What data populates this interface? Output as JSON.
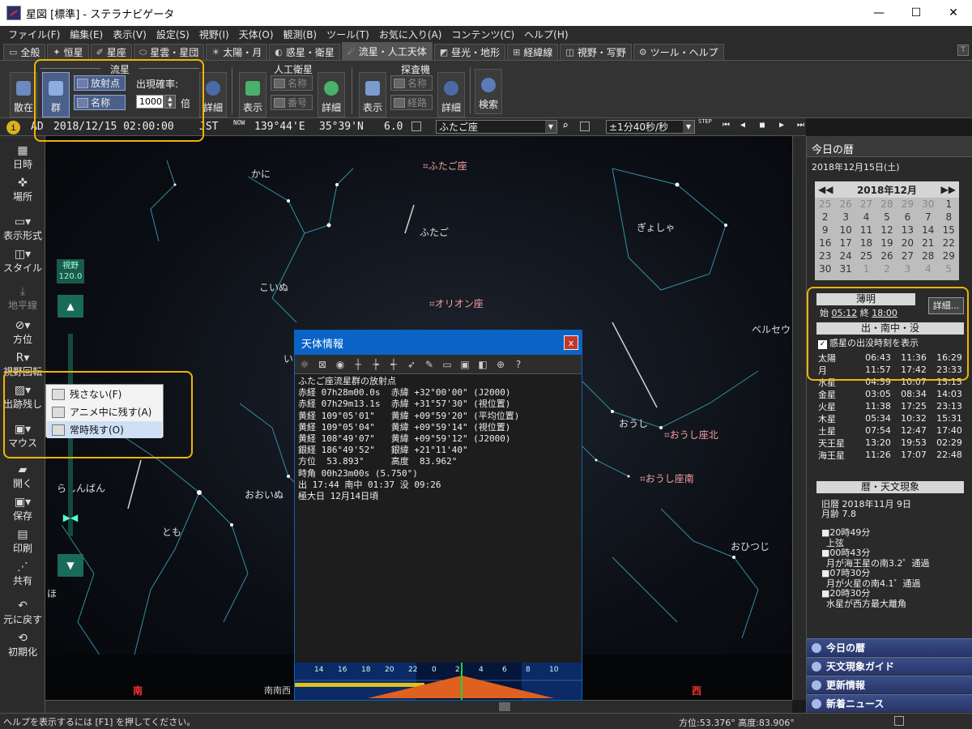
{
  "window": {
    "title": "星図 [標準] - ステラナビゲータ",
    "min": "—",
    "max": "☐",
    "close": "✕"
  },
  "menu": [
    "ファイル(F)",
    "編集(E)",
    "表示(V)",
    "設定(S)",
    "視野(I)",
    "天体(O)",
    "観測(B)",
    "ツール(T)",
    "お気に入り(A)",
    "コンテンツ(C)",
    "ヘルプ(H)"
  ],
  "tabs": [
    {
      "label": "全般",
      "icon": "▭"
    },
    {
      "label": "恒星",
      "icon": "✦"
    },
    {
      "label": "星座",
      "icon": "✐"
    },
    {
      "label": "星雲・星団",
      "icon": "⬭"
    },
    {
      "label": "太陽・月",
      "icon": "☀"
    },
    {
      "label": "惑星・衛星",
      "icon": "◐"
    },
    {
      "label": "流星・人工天体",
      "icon": "☄"
    },
    {
      "label": "昼光・地形",
      "icon": "◩"
    },
    {
      "label": "経緯線",
      "icon": "⊞"
    },
    {
      "label": "視野・写野",
      "icon": "◫"
    },
    {
      "label": "ツール・ヘルプ",
      "icon": "⚙"
    }
  ],
  "ribbon": {
    "meteor": {
      "title": "流星",
      "scatter": "散在",
      "group": "群",
      "radiant": "放射点",
      "name": "名称",
      "rate_label": "出現確率:",
      "rate_value": "1000",
      "rate_unit": "倍",
      "detail": "詳細"
    },
    "satellite": {
      "title": "人工衛星",
      "show": "表示",
      "name": "名称",
      "number": "番号",
      "detail": "詳細"
    },
    "probe": {
      "title": "探査機",
      "show": "表示",
      "name": "名称",
      "path": "経路",
      "detail": "詳細"
    },
    "search": "検索"
  },
  "infobar": {
    "era": "AD",
    "datetime": "2018/12/15 02:00:00",
    "tz": "JST",
    "now": "NOW",
    "lon": "139°44'E",
    "lat": "35°39'N",
    "mag": "6.0",
    "constellation": "ふたご座",
    "step": "±1分40秒/秒",
    "step_label": "STEP"
  },
  "left_toolbar": {
    "datetime": "日時",
    "place": "場所",
    "display": "表示形式",
    "style": "スタイル",
    "horizon": "地平線",
    "direction": "方位",
    "view_rotate": "視野回転",
    "trail": "出跡残し",
    "mouse": "マウス",
    "open": "開く",
    "save": "保存",
    "print": "印刷",
    "share": "共有",
    "undo": "元に戻す",
    "reset": "初期化"
  },
  "zoom": {
    "label": "視野",
    "value": "120.0"
  },
  "popup": {
    "items": [
      {
        "label": "残さない(F)"
      },
      {
        "label": "アニメ中に残す(A)"
      },
      {
        "label": "常時残す(O)"
      }
    ]
  },
  "sky_labels": {
    "kani": "かに",
    "futago": "ふたご",
    "futago_radiant": "ふたご座",
    "koinu": "こいぬ",
    "orion_radiant": "オリオン座",
    "gyosha": "ぎょしゃ",
    "perseus": "ベルセウ",
    "oushi": "おうし",
    "oushi_north": "おうし座北",
    "oushi_south": "おうし座南",
    "ooinu": "おおいぬ",
    "rashinban": "らしんばん",
    "tomo": "とも",
    "ohitsuji": "おひつじ",
    "i": "い",
    "ho": "ほ",
    "south": "南",
    "ssw": "南南西",
    "west": "西"
  },
  "dialog": {
    "title": "天体情報",
    "close": "x",
    "lines": [
      "ふたご座流星群の放射点",
      "赤経 07h28m00.0s  赤緯 +32°00'00\" (J2000)",
      "赤経 07h29m13.1s  赤緯 +31°57'30\" (視位置)",
      "黄経 109°05'01\"   黄緯 +09°59'20\" (平均位置)",
      "黄経 109°05'04\"   黄緯 +09°59'14\" (視位置)",
      "黄経 108°49'07\"   黄緯 +09°59'12\" (J2000)",
      "銀経 186°49'52\"   銀緯 +21°11'40\"",
      "方位  53.893°     高度  83.962°",
      "時角 00h23m00s (5.750°)",
      "出 17:44 南中 01:37 没 09:26",
      "極大日 12月14日頃"
    ],
    "hours": [
      "14",
      "16",
      "18",
      "20",
      "22",
      "0",
      "2",
      "4",
      "6",
      "8",
      "10"
    ]
  },
  "right_panel": {
    "title": "今日の暦",
    "date": "2018年12月15日(土)",
    "calendar": {
      "month": "2018年12月",
      "prev2": "◀◀",
      "prev": "◀",
      "next": "▶",
      "next2": "▶▶",
      "rows": [
        [
          "25",
          "26",
          "27",
          "28",
          "29",
          "30",
          "1"
        ],
        [
          "2",
          "3",
          "4",
          "5",
          "6",
          "7",
          "8"
        ],
        [
          "9",
          "10",
          "11",
          "12",
          "13",
          "14",
          "15"
        ],
        [
          "16",
          "17",
          "18",
          "19",
          "20",
          "21",
          "22"
        ],
        [
          "23",
          "24",
          "25",
          "26",
          "27",
          "28",
          "29"
        ],
        [
          "30",
          "31",
          "1",
          "2",
          "3",
          "4",
          "5"
        ]
      ]
    },
    "twilight": {
      "title": "薄明",
      "start_label": "始",
      "start": "05:12",
      "end_label": "終",
      "end": "18:00",
      "detail": "詳細..."
    },
    "rise_set": {
      "title": "出・南中・没",
      "checkbox": "惑星の出没時刻を表示",
      "rows": [
        [
          "太陽",
          "06:43",
          "11:36",
          "16:29"
        ],
        [
          "月",
          "11:57",
          "17:42",
          "23:33"
        ],
        [
          "水星",
          "04:59",
          "10:07",
          "15:15"
        ],
        [
          "金星",
          "03:05",
          "08:34",
          "14:03"
        ],
        [
          "火星",
          "11:38",
          "17:25",
          "23:13"
        ],
        [
          "木星",
          "05:34",
          "10:32",
          "15:31"
        ],
        [
          "土星",
          "07:54",
          "12:47",
          "17:40"
        ],
        [
          "天王星",
          "13:20",
          "19:53",
          "02:29"
        ],
        [
          "海王星",
          "11:26",
          "17:07",
          "22:48"
        ]
      ]
    },
    "calendar_events": {
      "title": "暦・天文現象",
      "lunar": "旧暦 2018年11月 9日",
      "age": "月齢 7.8",
      "events": [
        [
          "■20時49分",
          "上弦"
        ],
        [
          "■00時43分",
          "月が海王星の南3.2゜通過"
        ],
        [
          "■07時30分",
          "月が火星の南4.1゜通過"
        ],
        [
          "■20時30分",
          "水星が西方最大離角"
        ]
      ]
    },
    "nav": [
      "今日の暦",
      "天文現象ガイド",
      "更新情報",
      "新着ニュース"
    ]
  },
  "statusbar": {
    "help": "ヘルプを表示するには [F1] を押してください。",
    "coords": "方位:53.376° 高度:83.906°"
  },
  "colors": {
    "accent": "#0a64c8",
    "highlight": "#f0b400",
    "sky": "#0b0e14",
    "constellation_line": "#3aa6c0"
  }
}
